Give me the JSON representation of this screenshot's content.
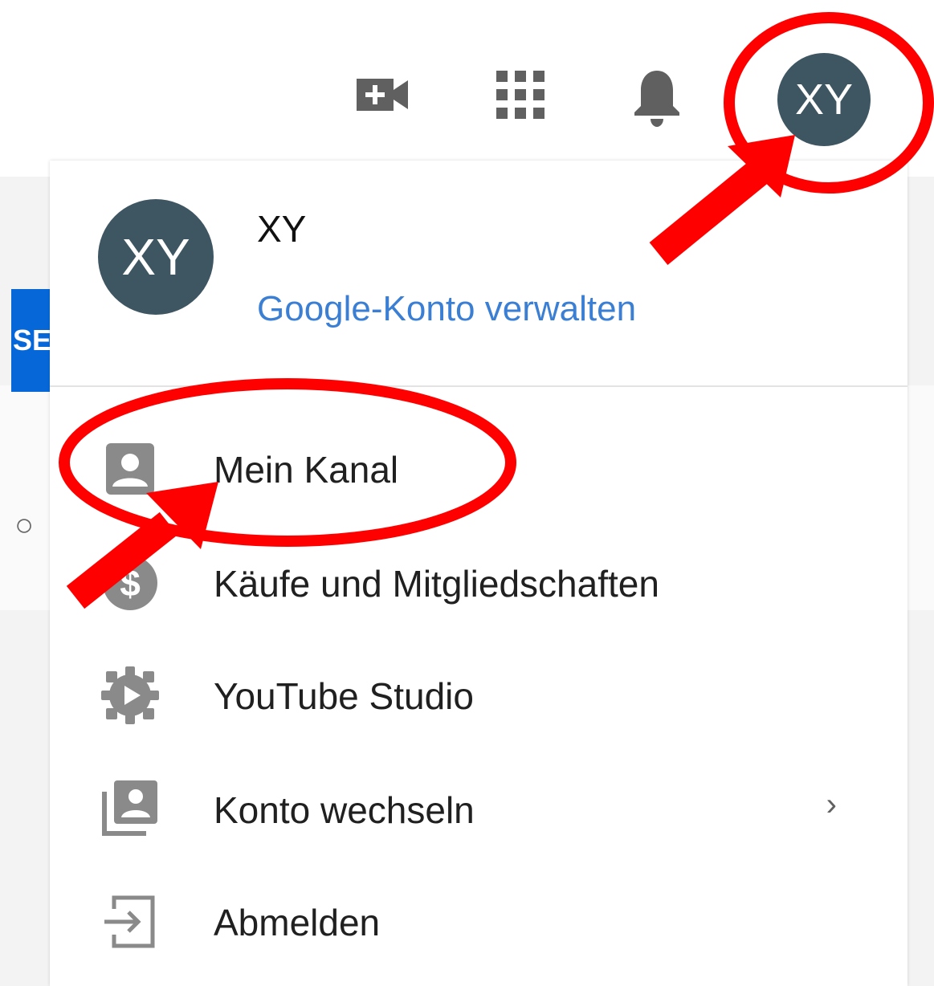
{
  "header": {
    "create_icon": "video-plus-icon",
    "apps_icon": "apps-grid-icon",
    "notifications_icon": "bell-icon",
    "avatar_initials": "XY"
  },
  "background": {
    "button_fragment": "SE"
  },
  "account": {
    "avatar_initials": "XY",
    "name": "XY",
    "manage_link": "Google-Konto verwalten"
  },
  "menu": {
    "items": [
      {
        "label": "Mein Kanal",
        "icon": "account-box-icon"
      },
      {
        "label": "Käufe und Mitgliedschaften",
        "icon": "dollar-icon"
      },
      {
        "label": "YouTube Studio",
        "icon": "gear-play-icon"
      },
      {
        "label": "Konto wechseln",
        "icon": "switch-account-icon",
        "chevron": "›"
      },
      {
        "label": "Abmelden",
        "icon": "exit-icon"
      }
    ]
  },
  "colors": {
    "annotation": "#ff0000",
    "avatar": "#3e5662",
    "link": "#3b7fd4"
  }
}
